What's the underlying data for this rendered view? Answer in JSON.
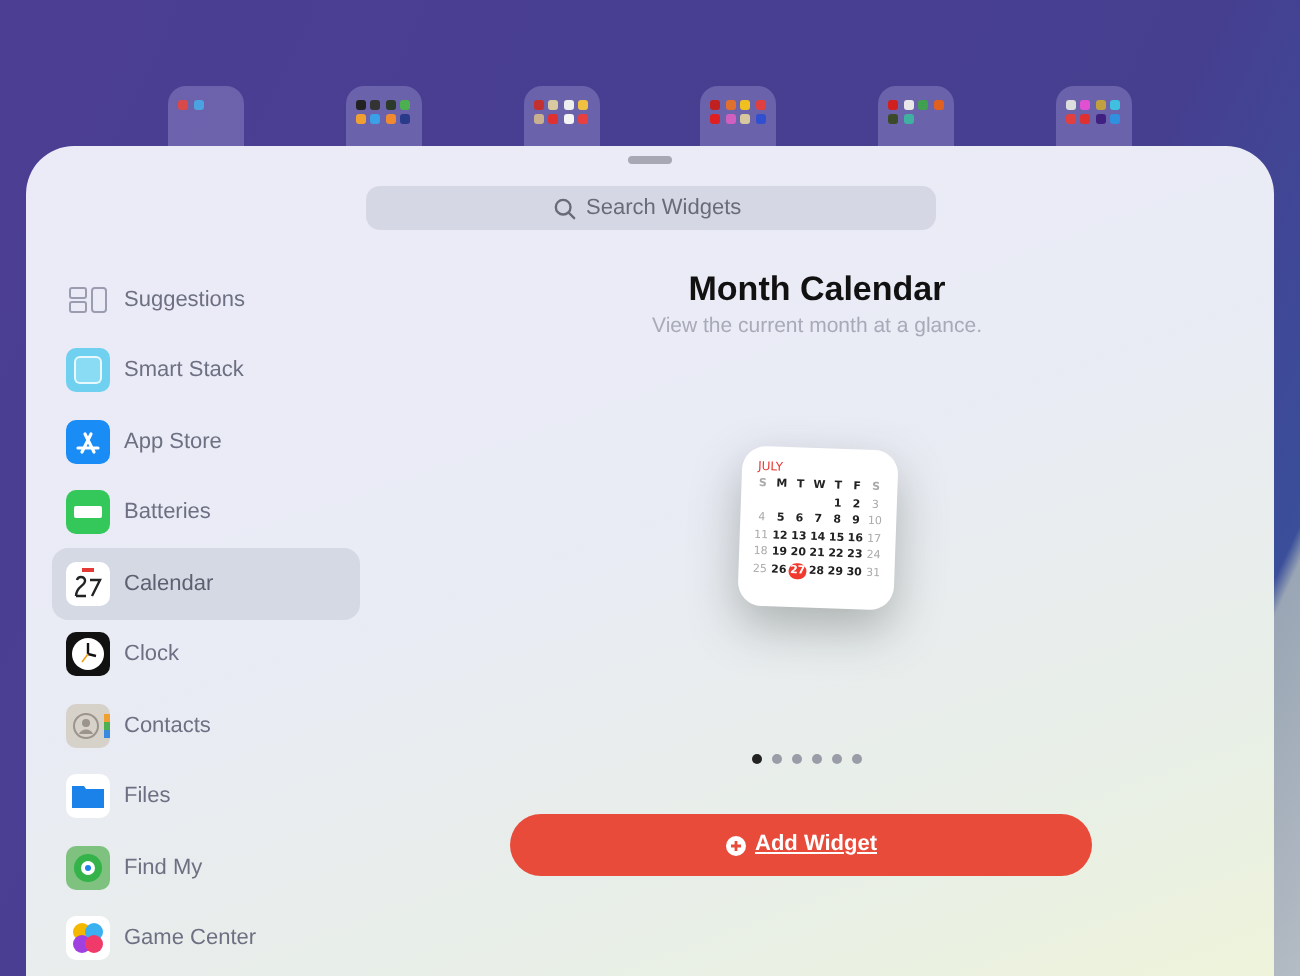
{
  "search": {
    "placeholder": "Search Widgets"
  },
  "sidebar": {
    "items": [
      {
        "label": "Suggestions",
        "selected": false
      },
      {
        "label": "Smart Stack",
        "selected": false
      },
      {
        "label": "App Store",
        "selected": false
      },
      {
        "label": "Batteries",
        "selected": false
      },
      {
        "label": "Calendar",
        "selected": true
      },
      {
        "label": "Clock",
        "selected": false
      },
      {
        "label": "Contacts",
        "selected": false
      },
      {
        "label": "Files",
        "selected": false
      },
      {
        "label": "Find My",
        "selected": false
      },
      {
        "label": "Game Center",
        "selected": false
      }
    ]
  },
  "widget": {
    "title": "Month Calendar",
    "subtitle": "View the current month at a glance.",
    "calendar": {
      "month": "JULY",
      "weekdays": [
        "S",
        "M",
        "T",
        "W",
        "T",
        "F",
        "S"
      ],
      "weeks": [
        [
          {
            "day": "1",
            "weekend": false,
            "today": false
          },
          {
            "day": "2",
            "weekend": false,
            "today": false
          },
          {
            "day": "3",
            "weekend": true,
            "today": false
          }
        ],
        [
          {
            "day": "4",
            "weekend": true,
            "today": false
          },
          {
            "day": "5",
            "weekend": false,
            "today": false
          },
          {
            "day": "6",
            "weekend": false,
            "today": false
          },
          {
            "day": "7",
            "weekend": false,
            "today": false
          },
          {
            "day": "8",
            "weekend": false,
            "today": false
          },
          {
            "day": "9",
            "weekend": false,
            "today": false
          },
          {
            "day": "10",
            "weekend": true,
            "today": false
          }
        ],
        [
          {
            "day": "11",
            "weekend": true,
            "today": false
          },
          {
            "day": "12",
            "weekend": false,
            "today": false
          },
          {
            "day": "13",
            "weekend": false,
            "today": false
          },
          {
            "day": "14",
            "weekend": false,
            "today": false
          },
          {
            "day": "15",
            "weekend": false,
            "today": false
          },
          {
            "day": "16",
            "weekend": false,
            "today": false
          },
          {
            "day": "17",
            "weekend": true,
            "today": false
          }
        ],
        [
          {
            "day": "18",
            "weekend": true,
            "today": false
          },
          {
            "day": "19",
            "weekend": false,
            "today": false
          },
          {
            "day": "20",
            "weekend": false,
            "today": false
          },
          {
            "day": "21",
            "weekend": false,
            "today": false
          },
          {
            "day": "22",
            "weekend": false,
            "today": false
          },
          {
            "day": "23",
            "weekend": false,
            "today": false
          },
          {
            "day": "24",
            "weekend": true,
            "today": false
          }
        ],
        [
          {
            "day": "25",
            "weekend": true,
            "today": false
          },
          {
            "day": "26",
            "weekend": false,
            "today": false
          },
          {
            "day": "27",
            "weekend": false,
            "today": true
          },
          {
            "day": "28",
            "weekend": false,
            "today": false
          },
          {
            "day": "29",
            "weekend": false,
            "today": false
          },
          {
            "day": "30",
            "weekend": false,
            "today": false
          },
          {
            "day": "31",
            "weekend": true,
            "today": false
          }
        ]
      ]
    },
    "pages": [
      {
        "selected": true
      },
      {
        "selected": false
      },
      {
        "selected": false
      },
      {
        "selected": false
      },
      {
        "selected": false
      },
      {
        "selected": false
      }
    ]
  },
  "add_button": {
    "label": "Add Widget"
  }
}
